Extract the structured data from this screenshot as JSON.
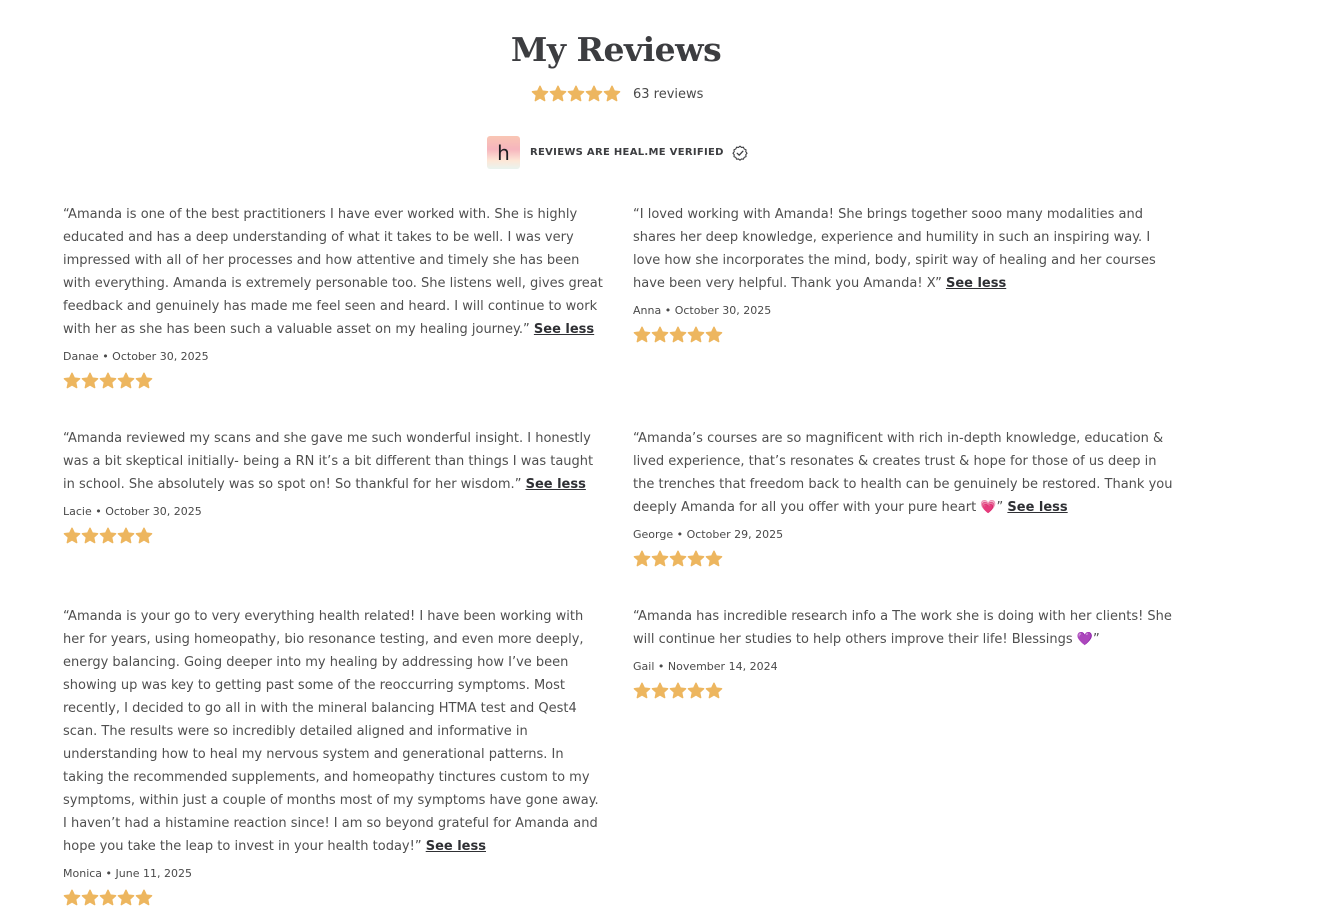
{
  "header": {
    "title": "My Reviews",
    "rating_stars": 5,
    "review_count": "63 reviews"
  },
  "verified": {
    "logo_letter": "h",
    "label": "REVIEWS ARE HEAL.ME VERIFIED",
    "icon": "check-circle-icon"
  },
  "colors": {
    "star": "#EDB65F",
    "title": "#3C3D40",
    "text": "#4F4F4F"
  },
  "reviews": [
    {
      "text": "“Amanda is one of the best practitioners I have ever worked with. She is highly educated and has a deep understanding of what it takes to be well. I was very impressed with all of her processes and how attentive and timely she has been with everything. Amanda is extremely personable too. She listens well, gives great feedback and genuinely has made me feel seen and heard. I will continue to work with her as she has been such a valuable asset on my healing journey.”",
      "toggle": "See less",
      "meta": "Danae • October 30, 2025",
      "stars": 5
    },
    {
      "text": "“I loved working with Amanda! She brings together sooo many modalities and shares her deep knowledge, experience and humility in such an inspiring way. I love how she incorporates the mind, body, spirit way of healing and her courses have been very helpful. Thank you Amanda! X”",
      "toggle": "See less",
      "meta": "Anna • October 30, 2025",
      "stars": 5
    },
    {
      "text": "“Amanda reviewed my scans and she gave me such wonderful insight. I honestly was a bit skeptical initially- being a RN it’s a bit different than things I was taught in school. She absolutely was so spot on! So thankful for her wisdom.”",
      "toggle": "See less",
      "meta": "Lacie • October 30, 2025",
      "stars": 5
    },
    {
      "text": "“Amanda’s courses are so magnificent with rich in-depth knowledge, education & lived experience, that’s resonates & creates trust & hope for those of us deep in the trenches that freedom back to health can be genuinely be restored. Thank you deeply Amanda for all you offer with your pure heart 💗”",
      "toggle": "See less",
      "meta": "George • October 29, 2025",
      "stars": 5
    },
    {
      "text": "“Amanda is your go to very everything health related! I have been working with her for years, using homeopathy, bio resonance testing, and even more deeply, energy balancing. Going deeper into my healing by addressing how I’ve been showing up was key to getting past some of the reoccurring symptoms. Most recently, I decided to go all in with the mineral balancing HTMA test and Qest4 scan. The results were so incredibly detailed aligned and informative in understanding how to heal my nervous system and generational patterns. In taking the recommended supplements, and homeopathy tinctures custom to my symptoms, within just a couple of months most of my symptoms have gone away. I haven’t had a histamine reaction since! I am so beyond grateful for Amanda and hope you take the leap to invest in your health today!”",
      "toggle": "See less",
      "meta": "Monica • June 11, 2025",
      "stars": 5
    },
    {
      "text": "“Amanda has incredible research info a The work she is doing with her clients! She will continue her studies to help others improve their life! Blessings 💜”",
      "toggle": "",
      "meta": "Gail • November 14, 2024",
      "stars": 5
    }
  ]
}
